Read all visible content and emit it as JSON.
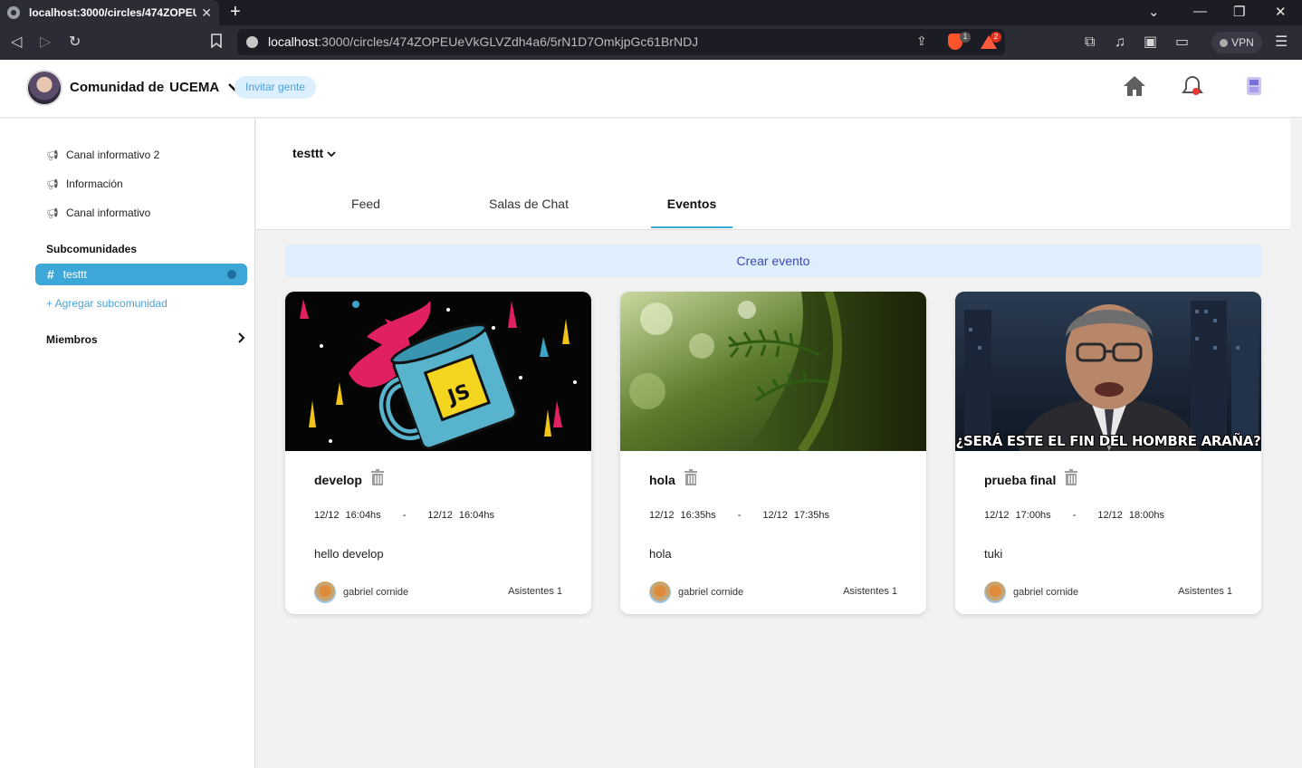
{
  "browser": {
    "tab_title": "localhost:3000/circles/474ZOPEU",
    "tab_close": "✕",
    "new_tab": "+",
    "url_host": "localhost",
    "url_rest": ":3000/circles/474ZOPEUeVkGLVZdh4a6/5rN1D7OmkjpGc61BrNDJ",
    "brave_badge": "1",
    "alert_badge": "2",
    "vpn_label": "VPN"
  },
  "header": {
    "community_prefix": "Comunidad de",
    "community_name": "UCEMA",
    "invite_label": "Invitar gente"
  },
  "sidebar": {
    "channels": [
      {
        "label": "Canal informativo 2"
      },
      {
        "label": "Información"
      },
      {
        "label": "Canal informativo"
      }
    ],
    "subcommunities_heading": "Subcomunidades",
    "active_subcommunity": "testtt",
    "add_subcommunity": "+ Agregar subcomunidad",
    "members_label": "Miembros"
  },
  "main": {
    "channel_title": "testtt",
    "tabs": [
      {
        "label": "Feed"
      },
      {
        "label": "Salas de Chat"
      },
      {
        "label": "Eventos"
      }
    ],
    "create_event_label": "Crear evento"
  },
  "events": [
    {
      "name": "develop",
      "start_day": "12/12",
      "start_time": "16:04hs",
      "end_day": "12/12",
      "end_time": "16:04hs",
      "description": "hello develop",
      "author": "gabriel cornide",
      "attendees": "Asistentes 1"
    },
    {
      "name": "hola",
      "start_day": "12/12",
      "start_time": "16:35hs",
      "end_day": "12/12",
      "end_time": "17:35hs",
      "description": "hola",
      "author": "gabriel cornide",
      "attendees": "Asistentes 1"
    },
    {
      "name": "prueba final",
      "start_day": "12/12",
      "start_time": "17:00hs",
      "end_day": "12/12",
      "end_time": "18:00hs",
      "description": "tuki",
      "author": "gabriel cornide",
      "attendees": "Asistentes 1",
      "image_caption": "¿SERÁ ESTE EL FIN DEL HOMBRE ARAÑA?"
    }
  ],
  "date_separator": "-",
  "colors": {
    "accent": "#3da8d8",
    "create_bg": "#deeefd",
    "create_text": "#3b4ab5",
    "invite_bg": "#dcefff"
  }
}
